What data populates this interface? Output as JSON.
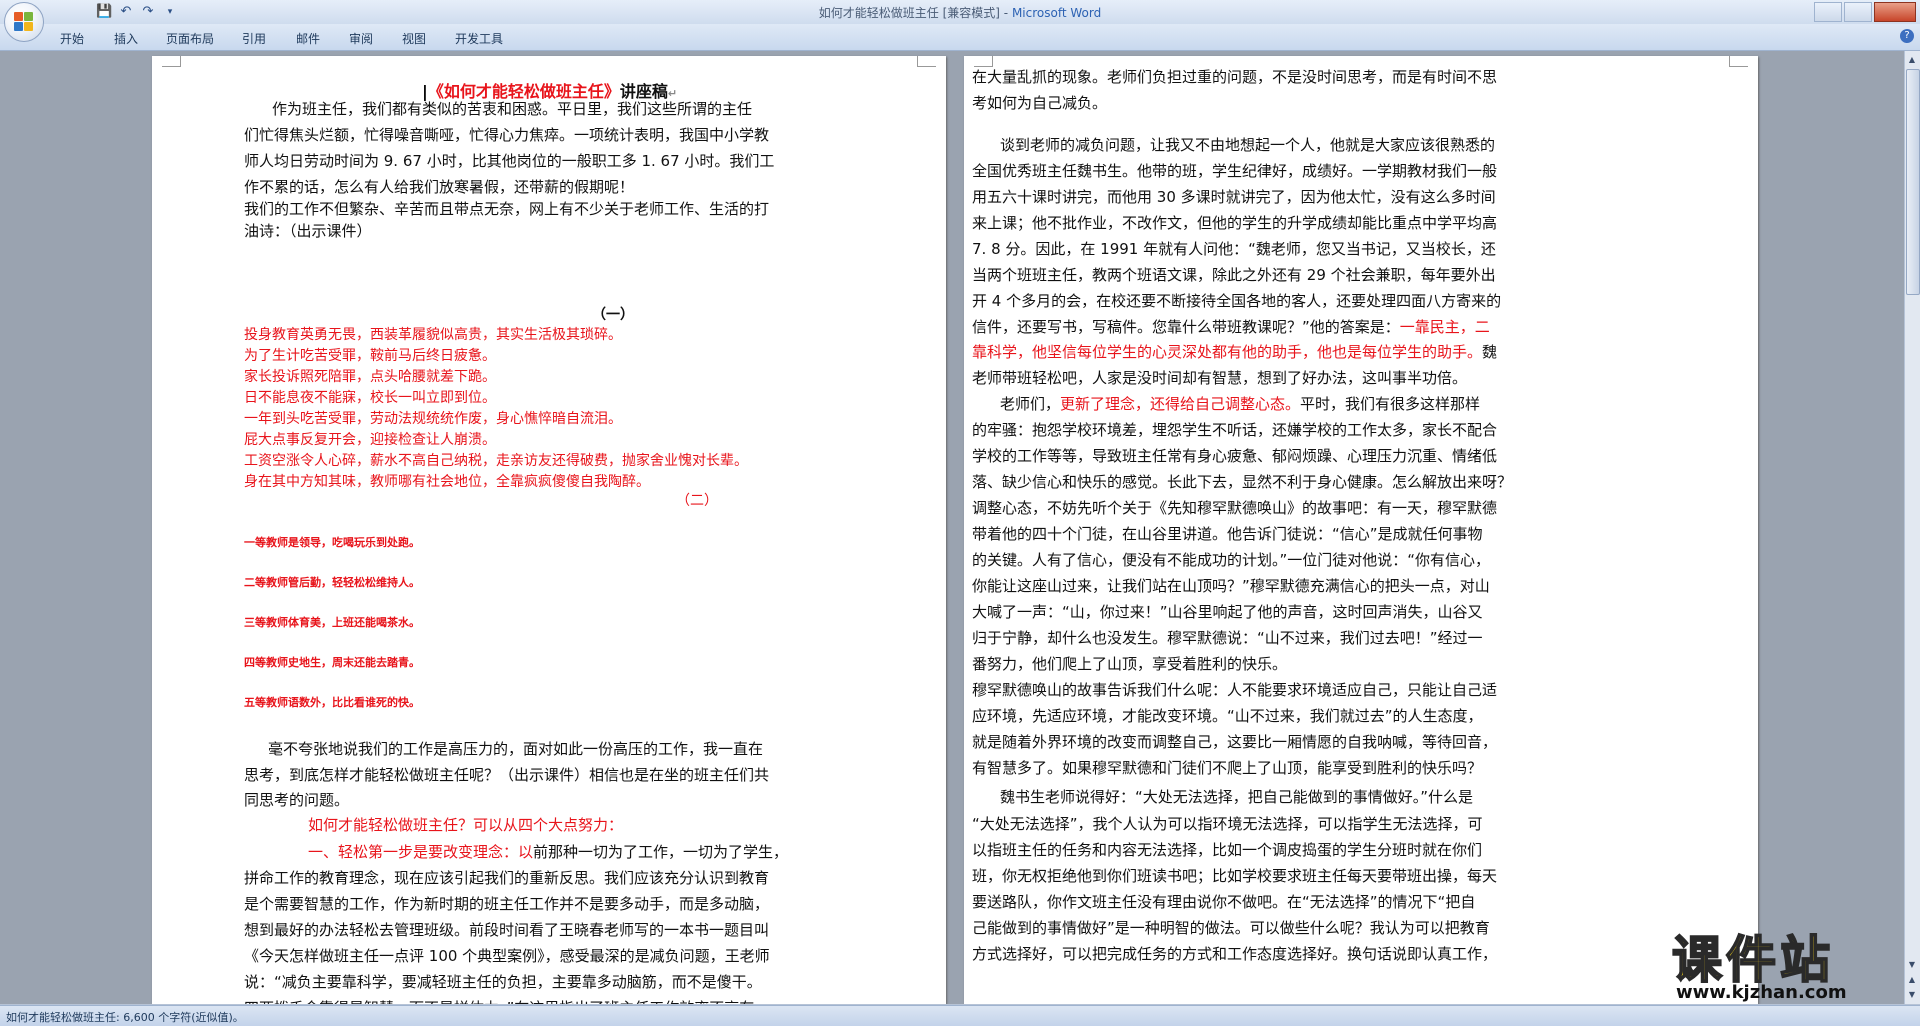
{
  "window": {
    "title": "如何才能轻松做班主任 [兼容模式]",
    "app_name": "Microsoft Word",
    "title_sep": " - "
  },
  "tabs": [
    "开始",
    "插入",
    "页面布局",
    "引用",
    "邮件",
    "审阅",
    "视图",
    "开发工具"
  ],
  "status_bar": {
    "text": "如何才能轻松做班主任: 6,600 个字符(近似值)。"
  },
  "watermark": {
    "text": "课件站",
    "url": "www.kjzhan.com"
  },
  "page1": {
    "title": "《如何才能轻松做班主任》",
    "title_suffix": "讲座稿",
    "lines": [
      {
        "t": "作为班主任，我们都有类似的苦衷和困惑。平日里，我们这些所谓的主任",
        "indent": true
      },
      {
        "t": "们忙得焦头烂额，忙得噪音嘶哑，忙得心力焦瘁。一项统计表明，我国中小学教"
      },
      {
        "t": "师人均日劳动时间为 9. 67 小时，比其他岗位的一般职工多 1. 67 小时。我们工"
      },
      {
        "t": "作不累的话，怎么有人给我们放寒暑假，还带薪的假期呢！"
      },
      {
        "t": "我们的工作不但繁杂、辛苦而且带点无奈，网上有不少关于老师工作、生活的打"
      },
      {
        "t": "油诗：（出示课件）"
      }
    ],
    "section1_label": "（一）",
    "poem1": [
      "投身教育英勇无畏，西装革履貌似高贵，其实生活极其琐碎。",
      "为了生计吃苦受罪，鞍前马后终日疲惫。",
      "家长投诉照死陪罪，点头哈腰就差下跪。",
      "日不能息夜不能寐，校长一叫立即到位。",
      "一年到头吃苦受罪，劳动法规统统作废，身心憔悴暗自流泪。",
      "屁大点事反复开会，迎接检查让人崩溃。",
      "工资空涨令人心碎，薪水不高自己纳税，走亲访友还得破费，抛家舍业愧对长辈。",
      "身在其中方知其味，教师哪有社会地位，全靠疯疯傻傻自我陶醉。"
    ],
    "section2_label": "（二）",
    "poem2": [
      "一等教师是领导，吃喝玩乐到处跑。",
      "二等教师管后勤，轻轻松松维持人。",
      "三等教师体育美，上班还能喝茶水。",
      "四等教师史地生，周末还能去踏青。",
      "五等教师语数外，比比看谁死的快。"
    ],
    "body2": [
      {
        "t": "毫不夸张地说我们的工作是高压力的，面对如此一份高压的工作，我一直在",
        "indent": true
      },
      {
        "t": "思考，到底怎样才能轻松做班主任呢？（出示课件）相信也是在坐的班主任们共"
      },
      {
        "t": "同思考的问题。"
      }
    ],
    "red_heading": "如何才能轻松做班主任？可以从四个大点努力：",
    "point1_red": "一、轻松第一步是要改变理念：以",
    "point1_rest": "前那种一切为了工作，一切为了学生，",
    "body3": [
      "拼命工作的教育理念，现在应该引起我们的重新反思。我们应该充分认识到教育",
      "是个需要智慧的工作，作为新时期的班主任工作并不是要多动手，而是多动脑，",
      "想到最好的办法轻松去管理班级。前段时间看了王晓春老师写的一本书一题目叫",
      "《今天怎样做班主任一点评 100 个典型案例》，感受最深的是减负问题，王老师",
      "说：“减负主要靠科学，要减轻班主任的负担，主要靠多动脑筋，而不是傻干。",
      "四两拨千金靠得是智慧，而不是拼体力。”在这里指出了班主任工作效率不高存"
    ]
  },
  "page2": {
    "lines": [
      {
        "t": "在大量乱抓的现象。老师们负担过重的问题，不是没时间思考，而是有时间不思"
      },
      {
        "t": "考如何为自己减负。"
      },
      {
        "t": "谈到老师的减负问题，让我又不由地想起一个人，他就是大家应该很熟悉的",
        "indent": true
      },
      {
        "t": "全国优秀班主任魏书生。他带的班，学生纪律好，成绩好。一学期教材我们一般"
      },
      {
        "t": "用五六十课时讲完，而他用 30 多课时就讲完了，因为他太忙，没有这么多时间"
      },
      {
        "t": "来上课；他不批作业，不改作文，但他的学生的升学成绩却能比重点中学平均高"
      },
      {
        "t": "7. 8 分。因此，在 1991 年就有人问他：“魏老师，您又当书记，又当校长，还"
      },
      {
        "t": "当两个班班主任，教两个班语文课，除此之外还有 29 个社会兼职，每年要外出"
      },
      {
        "t": "开 4 个多月的会，在校还要不断接待全国各地的客人，还要处理四面八方寄来的"
      },
      {
        "t": "信件，还要写书，写稿件。您靠什么带班教课呢？”他的答案是：",
        "red": "一靠民主，二"
      },
      {
        "red": "靠科学，他坚信每位学生的心灵深处都有他的助手，他也是每位学生的助手。",
        "t2": "魏"
      },
      {
        "t": "老师带班轻松吧，人家是没时间却有智慧，想到了好办法，这叫事半功倍。"
      },
      {
        "t": "老师们，",
        "indent": true,
        "red": "更新了理念，还得给自己调整心态。",
        "t2": "平时，我们有很多这样那样"
      },
      {
        "t": "的牢骚：抱怨学校环境差，埋怨学生不听话，还嫌学校的工作太多，家长不配合"
      },
      {
        "t": "学校的工作等等，导致班主任常有身心疲惫、郁闷烦躁、心理压力沉重、情绪低"
      },
      {
        "t": "落、缺少信心和快乐的感觉。长此下去，显然不利于身心健康。怎么解放出来呀？"
      },
      {
        "t": "调整心态，不妨先听个关于《先知穆罕默德唤山》的故事吧：有一天，穆罕默德"
      },
      {
        "t": "带着他的四十个门徒，在山谷里讲道。他告诉门徒说：“信心”是成就任何事物"
      },
      {
        "t": "的关键。人有了信心，便没有不能成功的计划。”一位门徒对他说：“你有信心，"
      },
      {
        "t": "你能让这座山过来，让我们站在山顶吗？”穆罕默德充满信心的把头一点，对山"
      },
      {
        "t": "大喊了一声：“山，你过来！”山谷里响起了他的声音，这时回声消失，山谷又"
      },
      {
        "t": "归于宁静，却什么也没发生。穆罕默德说：“山不过来，我们过去吧！”经过一"
      },
      {
        "t": "番努力，他们爬上了山顶，享受着胜利的快乐。"
      },
      {
        "t": "穆罕默德唤山的故事告诉我们什么呢：人不能要求环境适应自己，只能让自己适"
      },
      {
        "t": "应环境，先适应环境，才能改变环境。“山不过来，我们就过去”的人生态度，"
      },
      {
        "t": "就是随着外界环境的改变而调整自己，这要比一厢情愿的自我呐喊，等待回音，"
      },
      {
        "t": "有智慧多了。如果穆罕默德和门徒们不爬上了山顶，能享受到胜利的快乐吗？"
      },
      {
        "t": "魏书生老师说得好：“大处无法选择，把自己能做到的事情做好。”什么是",
        "indent": true
      },
      {
        "t": "“大处无法选择”，我个人认为可以指环境无法选择，可以指学生无法选择，可"
      },
      {
        "t": "以指班主任的任务和内容无法选择，比如一个调皮捣蛋的学生分班时就在你们"
      },
      {
        "t": "班，你无权拒绝他到你们班读书吧；比如学校要求班主任每天要带班出操，每天"
      },
      {
        "t": "要送路队，你作文班主任没有理由说你不做吧。在“无法选择”的情况下“把自"
      },
      {
        "t": "己能做到的事情做好”是一种明智的做法。可以做些什么呢？我认为可以把教育"
      },
      {
        "t": "方式选择好，可以把完成任务的方式和工作态度选择好。换句话说即认真工作，"
      }
    ]
  }
}
